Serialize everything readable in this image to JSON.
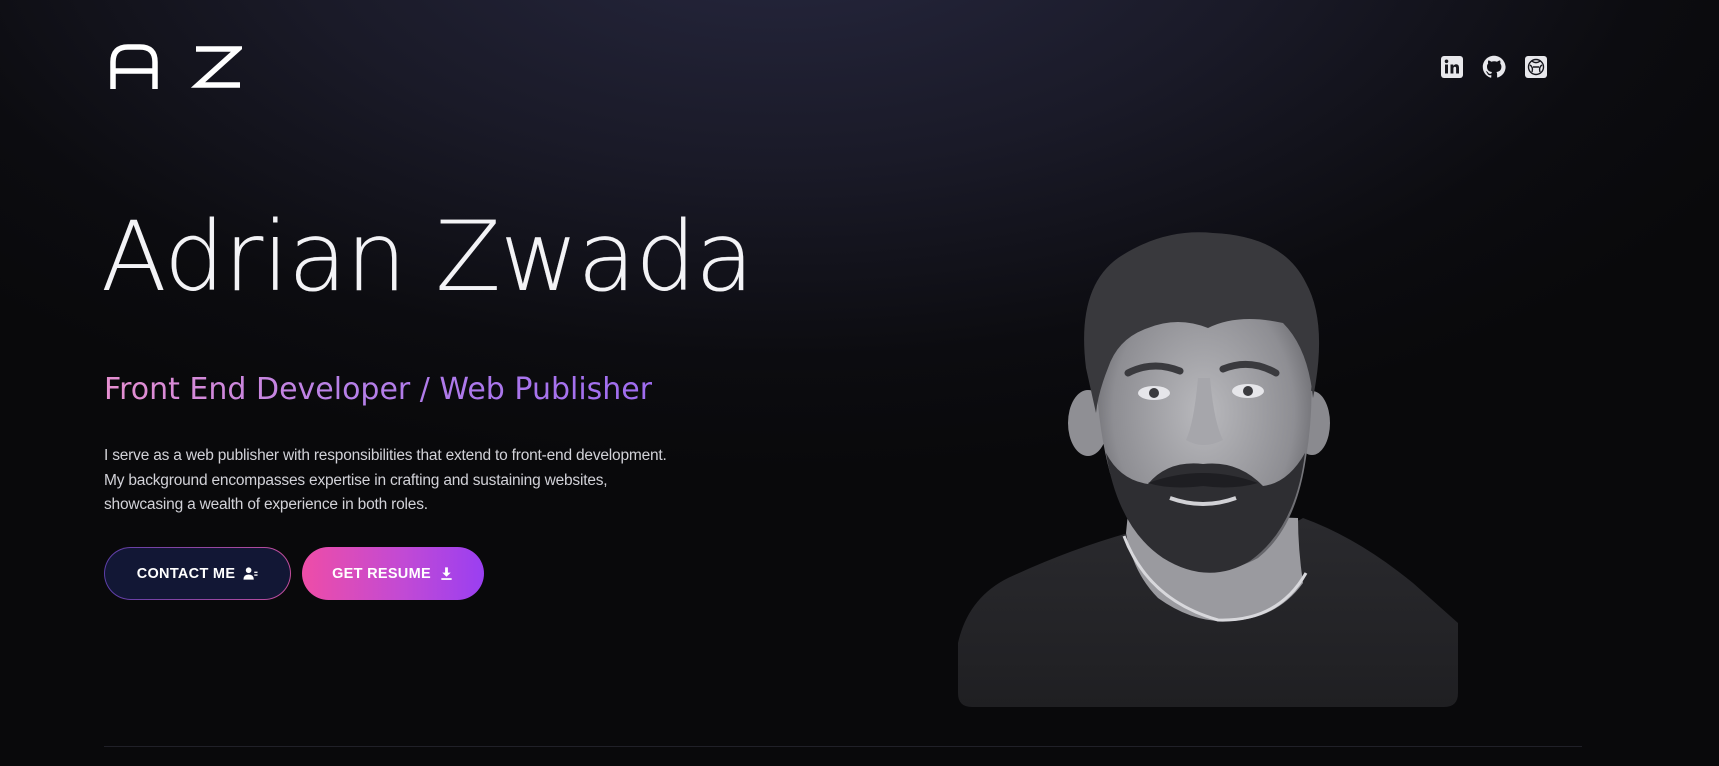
{
  "header": {
    "logo_text": "A Z",
    "social_links": [
      {
        "name": "linkedin",
        "icon": "linkedin-icon"
      },
      {
        "name": "github",
        "icon": "github-icon"
      },
      {
        "name": "codepen",
        "icon": "codepen-icon"
      }
    ]
  },
  "hero": {
    "name": "Adrian Zwada",
    "role": "Front End Developer / Web Publisher",
    "description_lines": [
      "I serve as a web publisher with responsibilities that extend to front-end development.",
      "My background encompasses expertise in crafting and sustaining websites,",
      "showcasing a wealth of experience in both roles."
    ],
    "buttons": {
      "contact_label": "CONTACT ME",
      "contact_icon": "contact-card-icon",
      "resume_label": "GET RESUME",
      "resume_icon": "download-icon"
    },
    "photo": {
      "style": "grayscale portrait, cut-out"
    }
  },
  "colors": {
    "accent_pink": "#ee4da7",
    "accent_purple": "#9a3ff1",
    "contact_bg": "#121735",
    "background_dark": "#09090b"
  }
}
